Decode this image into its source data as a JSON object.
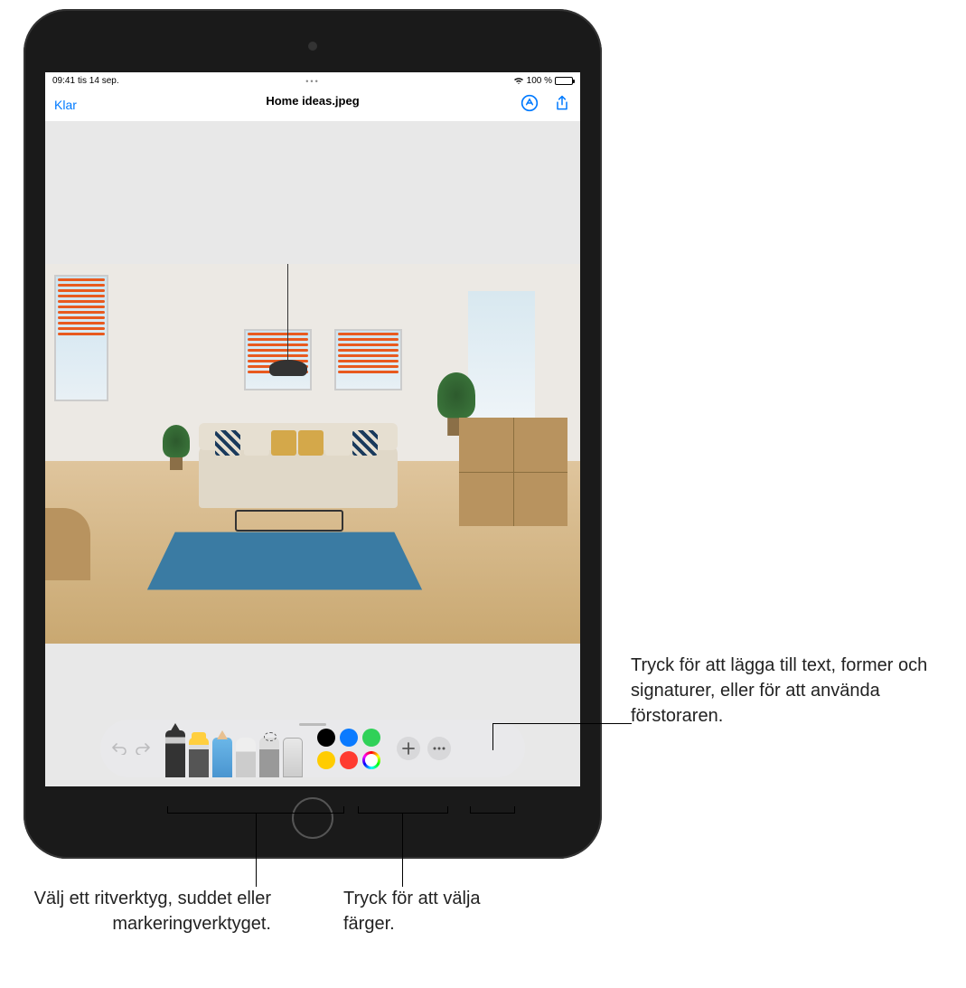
{
  "status": {
    "time": "09:41",
    "date": "tis 14 sep.",
    "battery": "100 %"
  },
  "nav": {
    "done": "Klar",
    "title": "Home ideas.jpeg"
  },
  "toolbar": {
    "tools": [
      "pen",
      "marker",
      "pencil",
      "eraser",
      "lasso",
      "ruler"
    ],
    "colors": {
      "black": "#000000",
      "blue": "#0a7aff",
      "green": "#30d158",
      "yellow": "#ffcc00",
      "red": "#ff3b30"
    }
  },
  "annotations": {
    "blind_color": "#e85a1f"
  },
  "callouts": {
    "add": "Tryck för att lägga till text, former och signaturer, eller för att använda förstoraren.",
    "colors": "Tryck för att välja färger.",
    "tools": "Välj ett ritverktyg, suddet eller markeringverktyget."
  }
}
